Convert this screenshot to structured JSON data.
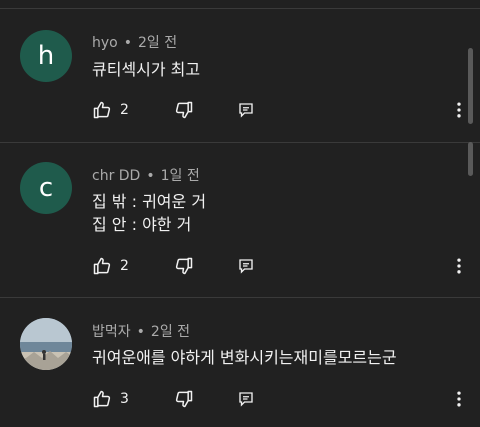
{
  "comments": [
    {
      "avatar_letter": "h",
      "avatar_color": "#1f5b4c",
      "author": "hyo",
      "time": "2일 전",
      "lines": [
        "큐티섹시가 최고"
      ],
      "likes": "2"
    },
    {
      "avatar_letter": "c",
      "avatar_color": "#1f5b4c",
      "author": "chr DD",
      "time": "1일 전",
      "lines": [
        "집 밖 : 귀여운 거",
        "집 안 : 야한 거"
      ],
      "likes": "2"
    },
    {
      "avatar_letter": "",
      "avatar_color": "#9fb4c4",
      "author": "밥먹자",
      "time": "2일 전",
      "lines": [
        "귀여운애를 야하게 변화시키는재미를모르는군"
      ],
      "likes": "3"
    }
  ],
  "icons": {
    "like": "thumb-up-icon",
    "dislike": "thumb-down-icon",
    "reply": "reply-icon",
    "more": "more-vertical-icon"
  }
}
